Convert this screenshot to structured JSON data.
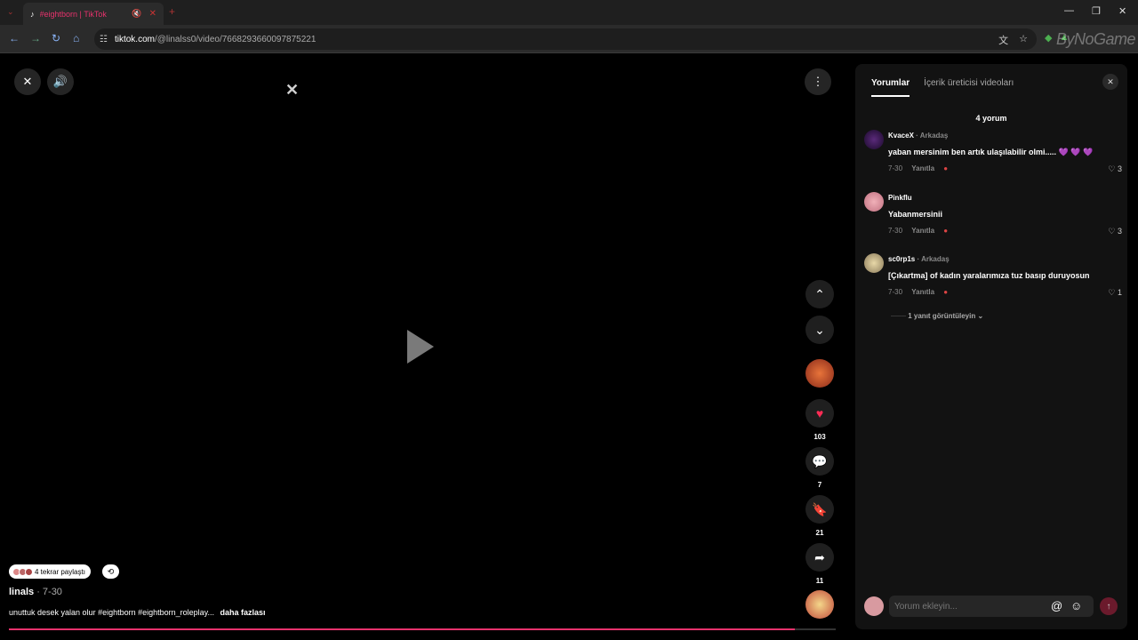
{
  "browser": {
    "tab_title": "#eightborn | TikTok",
    "url_host": "tiktok.com",
    "url_path": "/@linalss0/video/7668293660097875221",
    "watermark": "ByNoGame"
  },
  "video": {
    "reposted_text": "4 tekrar paylaştı",
    "author": "linals",
    "date": "· 7-30",
    "caption": "unuttuk desek yalan olur #eightborn #eightborn_roleplay...",
    "more_label": "daha fazlası",
    "progress": 0.95,
    "likes": "103",
    "comments": "7",
    "saves": "21",
    "shares": "11",
    "accent_color": "#e6326c"
  },
  "panel": {
    "tab_comments": "Yorumlar",
    "tab_creator_videos": "İçerik üreticisi videoları",
    "count": "4 yorum",
    "comments": [
      {
        "user": "KvaceX",
        "friend": "· Arkadaş",
        "text": "yaban mersinim ben artık ulaşılabilir olmi..... 💜 💜 💜",
        "date": "7-30",
        "reply": "Yanıtla",
        "likes": "3"
      },
      {
        "user": "Pinkflu",
        "friend": "",
        "text": "Yabanmersinii",
        "date": "7-30",
        "reply": "Yanıtla",
        "likes": "3"
      },
      {
        "user": "sc0rp1s",
        "friend": "· Arkadaş",
        "text": "[Çıkartma] of kadın yaralarımıza tuz basıp duruyosun",
        "date": "7-30",
        "reply": "Yanıtla",
        "likes": "1"
      }
    ],
    "view_replies": "1 yanıt görüntüleyin",
    "input_placeholder": "Yorum ekleyin..."
  }
}
